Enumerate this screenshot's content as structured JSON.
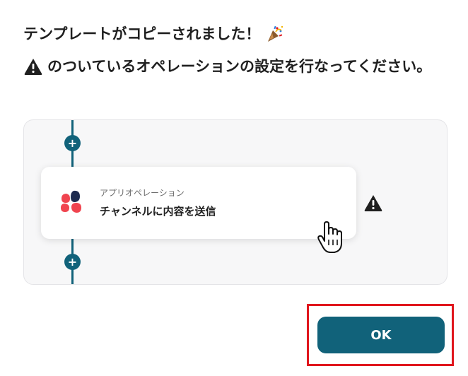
{
  "dialog": {
    "line1": "テンプレートがコピーされました！",
    "line2": "のついているオペレーションの設定を行なってください。"
  },
  "flow": {
    "add_top_label": "+",
    "add_bottom_label": "+",
    "operation": {
      "category": "アプリオペレーション",
      "name": "チャンネルに内容を送信"
    }
  },
  "actions": {
    "ok_label": "OK"
  },
  "colors": {
    "primary": "#11627a",
    "highlight": "#e0161d",
    "warning": "#1f1f1f",
    "logo_red": "#f0444f",
    "logo_navy": "#1d2b4f"
  },
  "icons": {
    "party": "party-popper-icon",
    "warning": "warning-icon",
    "add": "plus-icon",
    "logo": "app-logo",
    "cursor": "hand-pointer-icon"
  }
}
